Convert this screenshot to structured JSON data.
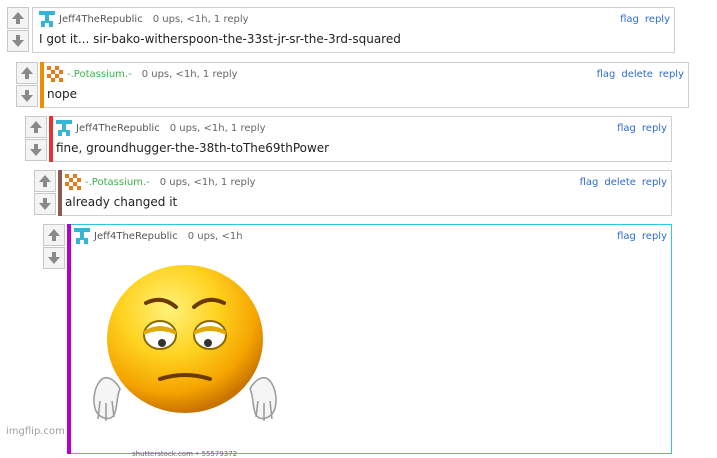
{
  "comments": [
    {
      "user": "Jeff4TheRepublic",
      "meta": "0 ups, <1h, 1 reply",
      "text": "I got it... sir-bako-witherspoon-the-33st-jr-sr-the-3rd-squared",
      "actions": [
        "flag",
        "reply"
      ],
      "avatar": "cyan-pixel-avatar"
    },
    {
      "user": "-.Potassium.-",
      "meta": "0 ups, <1h, 1 reply",
      "text": "nope",
      "actions": [
        "flag",
        "delete",
        "reply"
      ],
      "avatar": "orange-pixel-avatar",
      "bar_color": "#f08c00"
    },
    {
      "user": "Jeff4TheRepublic",
      "meta": "0 ups, <1h, 1 reply",
      "text": "fine, groundhugger-the-38th-toThe69thPower",
      "actions": [
        "flag",
        "reply"
      ],
      "avatar": "cyan-pixel-avatar",
      "bar_color": "#e83232"
    },
    {
      "user": "-.Potassium.-",
      "meta": "0 ups, <1h, 1 reply",
      "text": "already changed it",
      "actions": [
        "flag",
        "delete",
        "reply"
      ],
      "avatar": "orange-pixel-avatar",
      "bar_color": "#8c5a50"
    },
    {
      "user": "Jeff4TheRepublic",
      "meta": "0 ups, <1h",
      "text": "",
      "actions": [
        "flag",
        "reply"
      ],
      "avatar": "cyan-pixel-avatar",
      "bar_color": "#b400c8",
      "image_caption": "shutterstock.com • 55579372"
    }
  ],
  "watermark": "imgflip.com"
}
